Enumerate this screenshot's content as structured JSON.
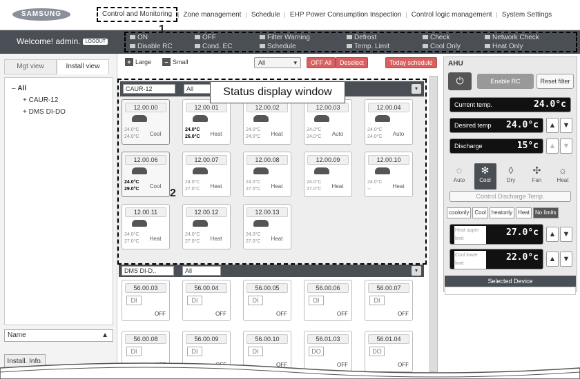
{
  "brand": "SAMSUNG",
  "nav": [
    "Control and Monitoring",
    "Zone management",
    "Schedule",
    "EHP Power Consumption Inspection",
    "Control logic management",
    "System Settings"
  ],
  "welcome": "Welcome! admin.",
  "logout": "LOGOUT",
  "legend": [
    "ON",
    "Disable RC",
    "OFF",
    "Cond. EC",
    "Filter Warning",
    "Schedule",
    "Defrost",
    "Temp. Limit",
    "Check",
    "Cool Only",
    "Network Check",
    "Heat Only"
  ],
  "sidebar": {
    "tabs": [
      "Mgt view",
      "Install view"
    ],
    "tree": [
      "All",
      "CAUR-12",
      "DMS DI-DO"
    ],
    "name_select": "Name",
    "install_info": "Install. Info."
  },
  "toolbar": {
    "large": "Large",
    "small": "Small",
    "all": "All",
    "off_all": "OFF All",
    "deselect": "Deselect",
    "today": "Today schedule"
  },
  "group1": {
    "name": "CAUR-12",
    "filter": "All"
  },
  "group2": {
    "name": "DMS DI-D..",
    "filter": "All"
  },
  "callout": "Status display window",
  "units": [
    {
      "id": "12.00.00",
      "t1": "24.0°C",
      "t2": "24.0°C",
      "mode": "Cool"
    },
    {
      "id": "12.00.01",
      "t1": "24.0°C",
      "t2": "26.0°C",
      "mode": "Heat"
    },
    {
      "id": "12.00.02",
      "t1": "24.0°C",
      "t2": "24.0°C",
      "mode": "Heat"
    },
    {
      "id": "12.00.03",
      "t1": "24.0°C",
      "t2": "24.0°C",
      "mode": "Auto"
    },
    {
      "id": "12.00.04",
      "t1": "24.0°C",
      "t2": "24.0°C",
      "mode": "Auto"
    },
    {
      "id": "12.00.06",
      "t1": "24.0°C",
      "t2": "29.0°C",
      "mode": "Cool"
    },
    {
      "id": "12.00.07",
      "t1": "24.0°C",
      "t2": "27.0°C",
      "mode": "Heat"
    },
    {
      "id": "12.00.08",
      "t1": "24.0°C",
      "t2": "27.0°C",
      "mode": "Heat"
    },
    {
      "id": "12.00.09",
      "t1": "24.0°C",
      "t2": "27.0°C",
      "mode": "Heat"
    },
    {
      "id": "12.00.10",
      "t1": "24.0°C",
      "t2": "--",
      "mode": "Heat"
    },
    {
      "id": "12.00.11",
      "t1": "24.0°C",
      "t2": "27.0°C",
      "mode": "Heat"
    },
    {
      "id": "12.00.12",
      "t1": "24.0°C",
      "t2": "27.0°C",
      "mode": "Heat"
    },
    {
      "id": "12.00.13",
      "t1": "24.0°C",
      "t2": "27.0°C",
      "mode": "Heat"
    }
  ],
  "dio": [
    {
      "id": "56.00.03",
      "io": "DI",
      "st": "OFF"
    },
    {
      "id": "56.00.04",
      "io": "DI",
      "st": "OFF"
    },
    {
      "id": "56.00.05",
      "io": "DI",
      "st": "OFF"
    },
    {
      "id": "56.00.06",
      "io": "DI",
      "st": "OFF"
    },
    {
      "id": "56.00.07",
      "io": "DI",
      "st": "OFF"
    },
    {
      "id": "56.00.08",
      "io": "DI",
      "st": "OFF"
    },
    {
      "id": "56.00.09",
      "io": "DI",
      "st": "OFF"
    },
    {
      "id": "56.00.10",
      "io": "DI",
      "st": "OFF"
    },
    {
      "id": "56.01.03",
      "io": "DO",
      "st": "OFF"
    },
    {
      "id": "56.01.04",
      "io": "DO",
      "st": "OFF"
    }
  ],
  "panel": {
    "title": "AHU",
    "enable_rc": "Enable RC",
    "reset_filter": "Reset filter",
    "current_label": "Current temp.",
    "current_val": "24.0°c",
    "desired_label": "Desired temp",
    "desired_val": "24.0°c",
    "discharge_label": "Discharge",
    "discharge_val": "15°c",
    "modes": [
      "Auto",
      "Cool",
      "Dry",
      "Fan",
      "Heat"
    ],
    "control_discharge": "Control Discharge Temp.",
    "limits": [
      "coolonly",
      "Cool",
      "heatonly",
      "Heat",
      "No limits"
    ],
    "heat_upper": "Heat upper limit",
    "heat_upper_val": "27.0°c",
    "cool_lower": "Cool lower limit",
    "cool_lower_val": "22.0°c",
    "selected": "Selected Device"
  },
  "markers": [
    "1",
    "2"
  ]
}
